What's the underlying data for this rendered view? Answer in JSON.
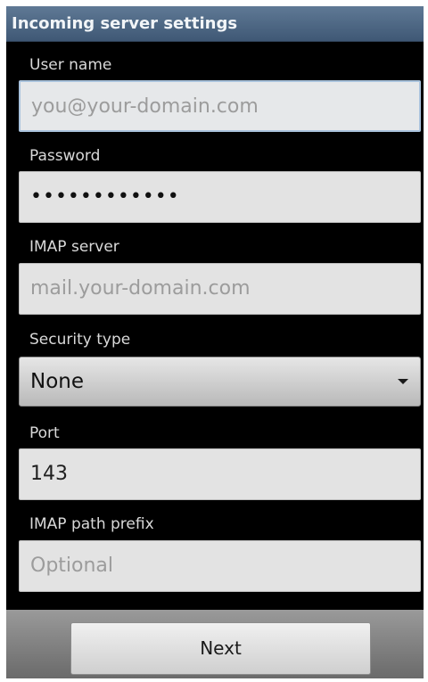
{
  "header": {
    "title": "Incoming server settings"
  },
  "form": {
    "username_label": "User name",
    "username_placeholder": "you@your-domain.com",
    "password_label": "Password",
    "password_value": "••••••••••••",
    "imap_server_label": "IMAP server",
    "imap_server_placeholder": "mail.your-domain.com",
    "security_type_label": "Security type",
    "security_type_value": "None",
    "port_label": "Port",
    "port_value": "143",
    "imap_path_prefix_label": "IMAP path prefix",
    "imap_path_prefix_placeholder": "Optional"
  },
  "footer": {
    "next_label": "Next"
  }
}
